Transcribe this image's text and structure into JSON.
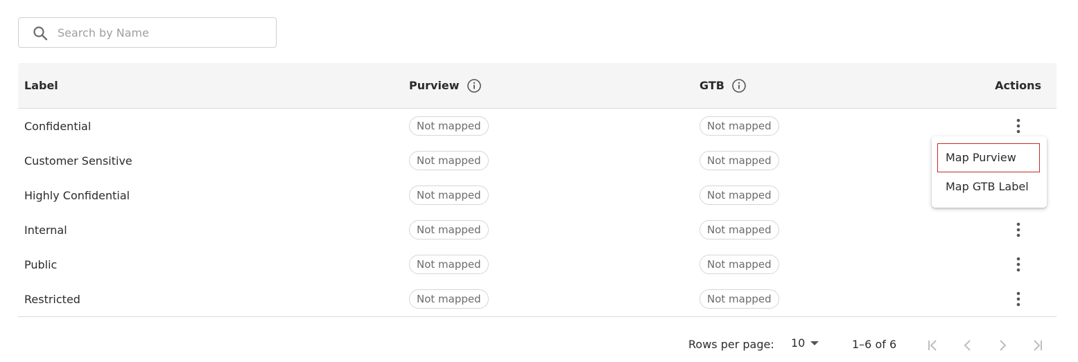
{
  "search": {
    "placeholder": "Search by Name",
    "value": "",
    "icon": "search-icon"
  },
  "table": {
    "headers": {
      "label": "Label",
      "purview": "Purview",
      "gtb": "GTB",
      "actions": "Actions"
    },
    "rows": [
      {
        "label": "Confidential",
        "purview": "Not mapped",
        "gtb": "Not mapped"
      },
      {
        "label": "Customer Sensitive",
        "purview": "Not mapped",
        "gtb": "Not mapped"
      },
      {
        "label": "Highly Confidential",
        "purview": "Not mapped",
        "gtb": "Not mapped"
      },
      {
        "label": "Internal",
        "purview": "Not mapped",
        "gtb": "Not mapped"
      },
      {
        "label": "Public",
        "purview": "Not mapped",
        "gtb": "Not mapped"
      },
      {
        "label": "Restricted",
        "purview": "Not mapped",
        "gtb": "Not mapped"
      }
    ]
  },
  "action_menu": {
    "items": [
      "Map Purview",
      "Map GTB Label"
    ],
    "highlighted_item": "Map Purview",
    "highlight_color": "#c62828"
  },
  "pagination": {
    "rows_per_page_label": "Rows per page:",
    "rows_per_page_value": "10",
    "range_text": "1–6 of 6"
  },
  "colors": {
    "header_bg": "#f5f5f5",
    "chip_border": "#d6d6d6",
    "chip_text": "#6b6b6b",
    "disabled_nav": "#bdbdbd"
  }
}
